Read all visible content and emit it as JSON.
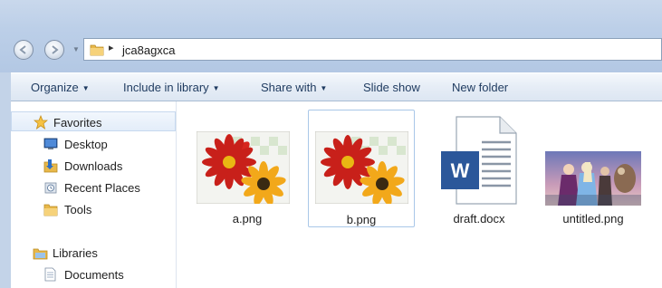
{
  "address_bar": {
    "path": "jca8agxca",
    "separator": "▸"
  },
  "toolbar": {
    "items": [
      {
        "label": "Organize",
        "dropdown": true
      },
      {
        "label": "Include in library",
        "dropdown": true
      },
      {
        "label": "Share with",
        "dropdown": true
      },
      {
        "label": "Slide show",
        "dropdown": false
      },
      {
        "label": "New folder",
        "dropdown": false
      }
    ]
  },
  "nav_pane": {
    "favorites": {
      "label": "Favorites",
      "items": [
        {
          "label": "Desktop",
          "icon": "desktop-icon"
        },
        {
          "label": "Downloads",
          "icon": "downloads-folder-icon"
        },
        {
          "label": "Recent Places",
          "icon": "recent-places-icon"
        },
        {
          "label": "Tools",
          "icon": "folder-icon"
        }
      ]
    },
    "libraries": {
      "label": "Libraries",
      "items": [
        {
          "label": "Documents",
          "icon": "documents-icon"
        }
      ]
    }
  },
  "files": [
    {
      "name": "a.png",
      "type": "image",
      "thumbnail": "flower-thumbnail",
      "selected": false
    },
    {
      "name": "b.png",
      "type": "image",
      "thumbnail": "flower-thumbnail",
      "selected": true
    },
    {
      "name": "draft.docx",
      "type": "document",
      "thumbnail": "word-document-icon",
      "selected": false
    },
    {
      "name": "untitled.png",
      "type": "image",
      "thumbnail": "movie-poster-thumbnail",
      "selected": false
    }
  ],
  "colors": {
    "chrome": "#bccfe8",
    "command_bar": "#e6edf6",
    "selection_border": "#a9c7e8",
    "word_blue": "#2b579a"
  }
}
